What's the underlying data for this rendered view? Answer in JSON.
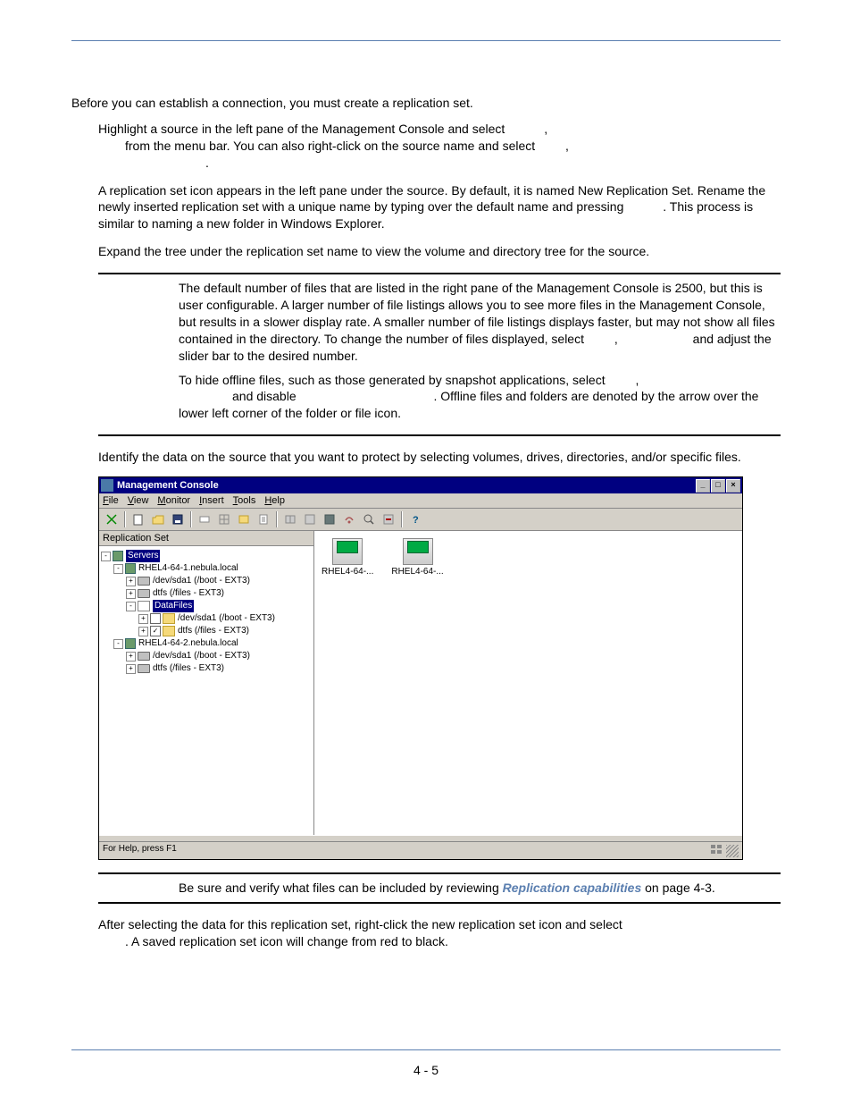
{
  "intro": "Before you can establish a connection, you must create a replication set.",
  "step1": {
    "line1": "Highlight a source in the left pane of the Management Console and select",
    "line2": "from the menu bar. You can also right-click on the source name and select",
    "c1": ",",
    "c2": ",",
    "dot": "."
  },
  "step2": {
    "a": "A replication set icon appears in the left pane under the source. By default, it is named New Replication Set. Rename the newly inserted replication set with a unique name by typing over the default name and pressing",
    "b": ". This process is similar to naming a new folder in Windows Explorer."
  },
  "step3": "Expand the tree under the replication set name to view the volume and directory tree for the source.",
  "note1": {
    "p1a": "The default number of files that are listed in the right pane of the Management Console is 2500, but this is user configurable.   A larger number of file listings allows you to see more files in the Management Console, but results in a slower display rate. A smaller number of file listings displays faster, but may not show all files contained in the directory. To change the number of files displayed, select",
    "c1": ",",
    "p1b": "and adjust the",
    "p1c": "slider bar to the desired number.",
    "p2a": "To hide offline files, such as those generated by snapshot applications, select",
    "c2": ",",
    "p2b": "and disable",
    "p2c": ". Offline files and folders are denoted by the arrow over the lower left corner of the folder or file icon."
  },
  "step4": "Identify the data on the source that you want to protect by selecting volumes, drives, directories, and/or specific files.",
  "note2": {
    "a": "Be sure and verify what files can be included by reviewing ",
    "link": "Replication capabilities",
    "b": " on page 4-3."
  },
  "step5": {
    "a": "After selecting the data for this replication set, right-click the new replication set icon and select",
    "b": ".  A saved replication set icon will change from red to black."
  },
  "page_number": "4 - 5",
  "mc": {
    "title": "Management Console",
    "menus": [
      "File",
      "View",
      "Monitor",
      "Insert",
      "Tools",
      "Help"
    ],
    "left_header": "Replication Set",
    "tree": {
      "root": "Servers",
      "host1": "RHEL4-64-1.nebula.local",
      "host1_sda": "/dev/sda1 (/boot - EXT3)",
      "host1_dtfs": "dtfs (/files - EXT3)",
      "repset": "DataFiles",
      "rs_sda": "/dev/sda1 (/boot - EXT3)",
      "rs_dtfs": "dtfs (/files - EXT3)",
      "host2": "RHEL4-64-2.nebula.local",
      "host2_sda": "/dev/sda1 (/boot - EXT3)",
      "host2_dtfs": "dtfs (/files - EXT3)"
    },
    "right_items": [
      "RHEL4-64-...",
      "RHEL4-64-..."
    ],
    "status": "For Help, press F1"
  }
}
